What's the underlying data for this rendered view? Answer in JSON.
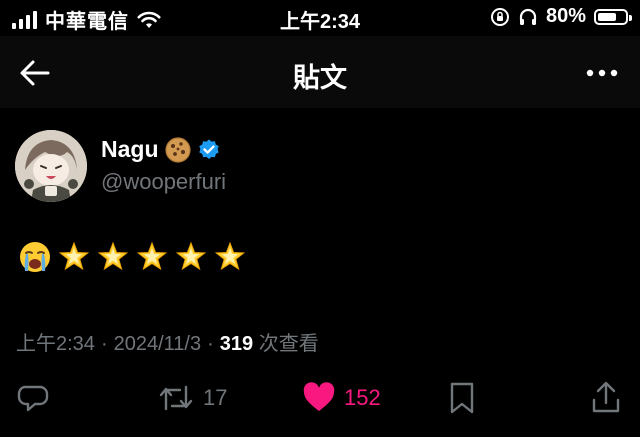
{
  "status_bar": {
    "carrier": "中華電信",
    "time": "上午2:34",
    "battery": "80%",
    "battery_level": 0.8
  },
  "nav": {
    "title": "貼文",
    "back_icon": "arrow-left-icon",
    "more_icon": "more-horizontal-icon"
  },
  "author": {
    "name": "Nagu",
    "name_emoji": "cookie-icon",
    "verified": true,
    "handle": "@wooperfuri"
  },
  "tweet": {
    "emojis": [
      "loudly-crying-face",
      "glowing-star",
      "glowing-star",
      "glowing-star",
      "glowing-star",
      "glowing-star"
    ]
  },
  "meta": {
    "time": "上午2:34",
    "separator1": "·",
    "date": "2024/11/3",
    "separator2": "·",
    "views_count": "319",
    "views_label": "次查看"
  },
  "actions": {
    "reply_icon": "reply-icon",
    "retweet_icon": "retweet-icon",
    "retweet_count": "17",
    "like_icon": "heart-icon",
    "like_count": "152",
    "bookmark_icon": "bookmark-icon",
    "share_icon": "share-icon"
  },
  "colors": {
    "background": "#000000",
    "text_secondary": "#71767b",
    "like": "#f91880",
    "verified": "#1d9bf0"
  }
}
